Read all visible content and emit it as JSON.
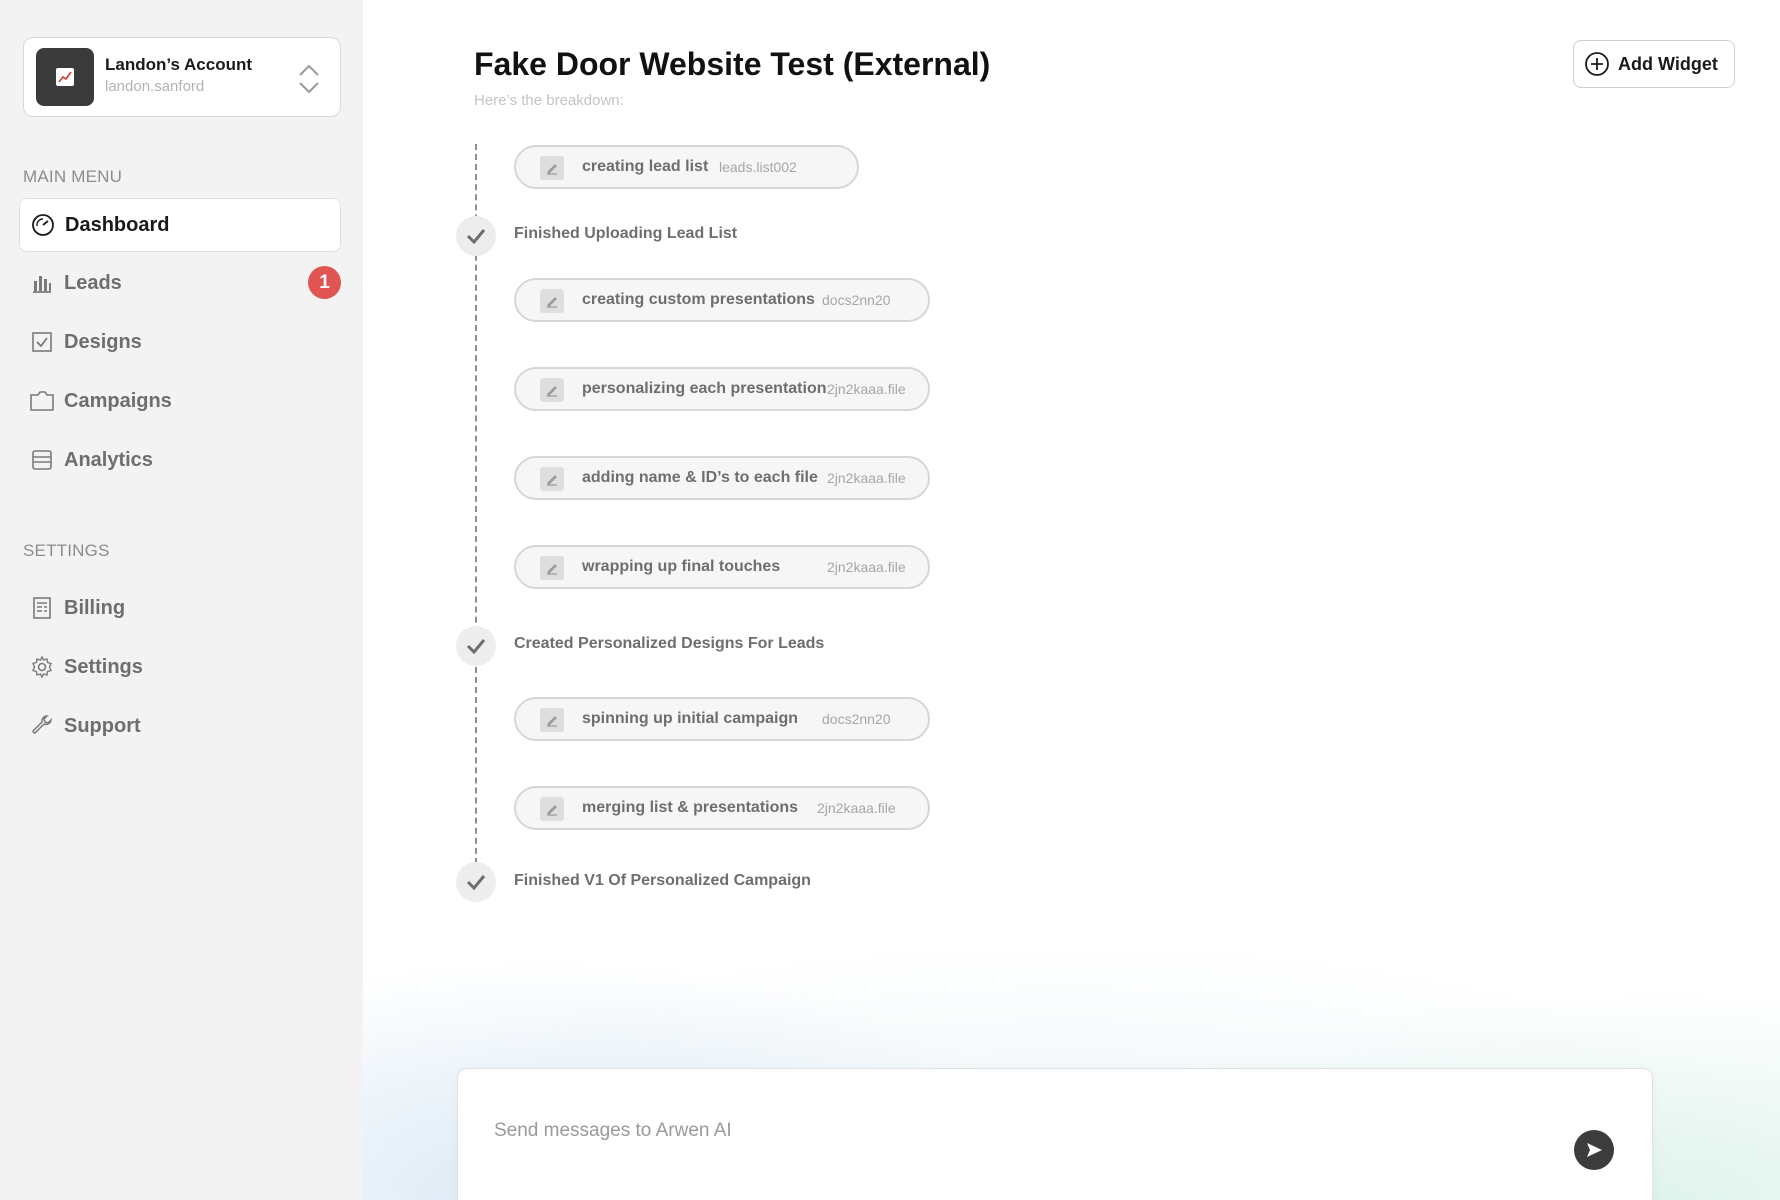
{
  "account": {
    "name": "Landon’s Account",
    "handle": "landon.sanford"
  },
  "sidebar": {
    "main_menu_label": "MAIN MENU",
    "settings_label": "SETTINGS",
    "main_items": [
      {
        "label": "Dashboard",
        "icon": "gauge-icon",
        "active": true
      },
      {
        "label": "Leads",
        "icon": "bar-chart-icon",
        "badge": "1"
      },
      {
        "label": "Designs",
        "icon": "checkbox-icon"
      },
      {
        "label": "Campaigns",
        "icon": "folder-icon"
      },
      {
        "label": "Analytics",
        "icon": "archive-icon"
      }
    ],
    "settings_items": [
      {
        "label": "Billing",
        "icon": "receipt-icon"
      },
      {
        "label": "Settings",
        "icon": "gear-icon"
      },
      {
        "label": "Support",
        "icon": "wrench-icon"
      }
    ]
  },
  "header": {
    "title": "Fake Door Website Test (External)",
    "subtitle": "Here’s the breakdown:",
    "add_widget_label": "Add Widget"
  },
  "timeline": {
    "tasks": [
      {
        "name": "creating lead list",
        "file": "leads.list002"
      },
      {
        "name": "creating custom presentations",
        "file": "docs2nn20"
      },
      {
        "name": "personalizing each presentation",
        "file": "2jn2kaaa.file"
      },
      {
        "name": "adding name & ID’s to each file",
        "file": "2jn2kaaa.file"
      },
      {
        "name": "wrapping up final touches",
        "file": "2jn2kaaa.file"
      },
      {
        "name": "spinning up initial campaign",
        "file": "docs2nn20"
      },
      {
        "name": "merging list & presentations",
        "file": "2jn2kaaa.file"
      }
    ],
    "milestones": [
      {
        "label": "Finished Uploading Lead List"
      },
      {
        "label": "Created Personalized Designs For Leads"
      },
      {
        "label": "Finished V1 Of Personalized Campaign"
      }
    ]
  },
  "composer": {
    "placeholder": "Send messages to Arwen AI"
  },
  "colors": {
    "badge": "#e05552",
    "sidebar_bg": "#f3f3f3",
    "accent_dark": "#3c3c3c"
  }
}
